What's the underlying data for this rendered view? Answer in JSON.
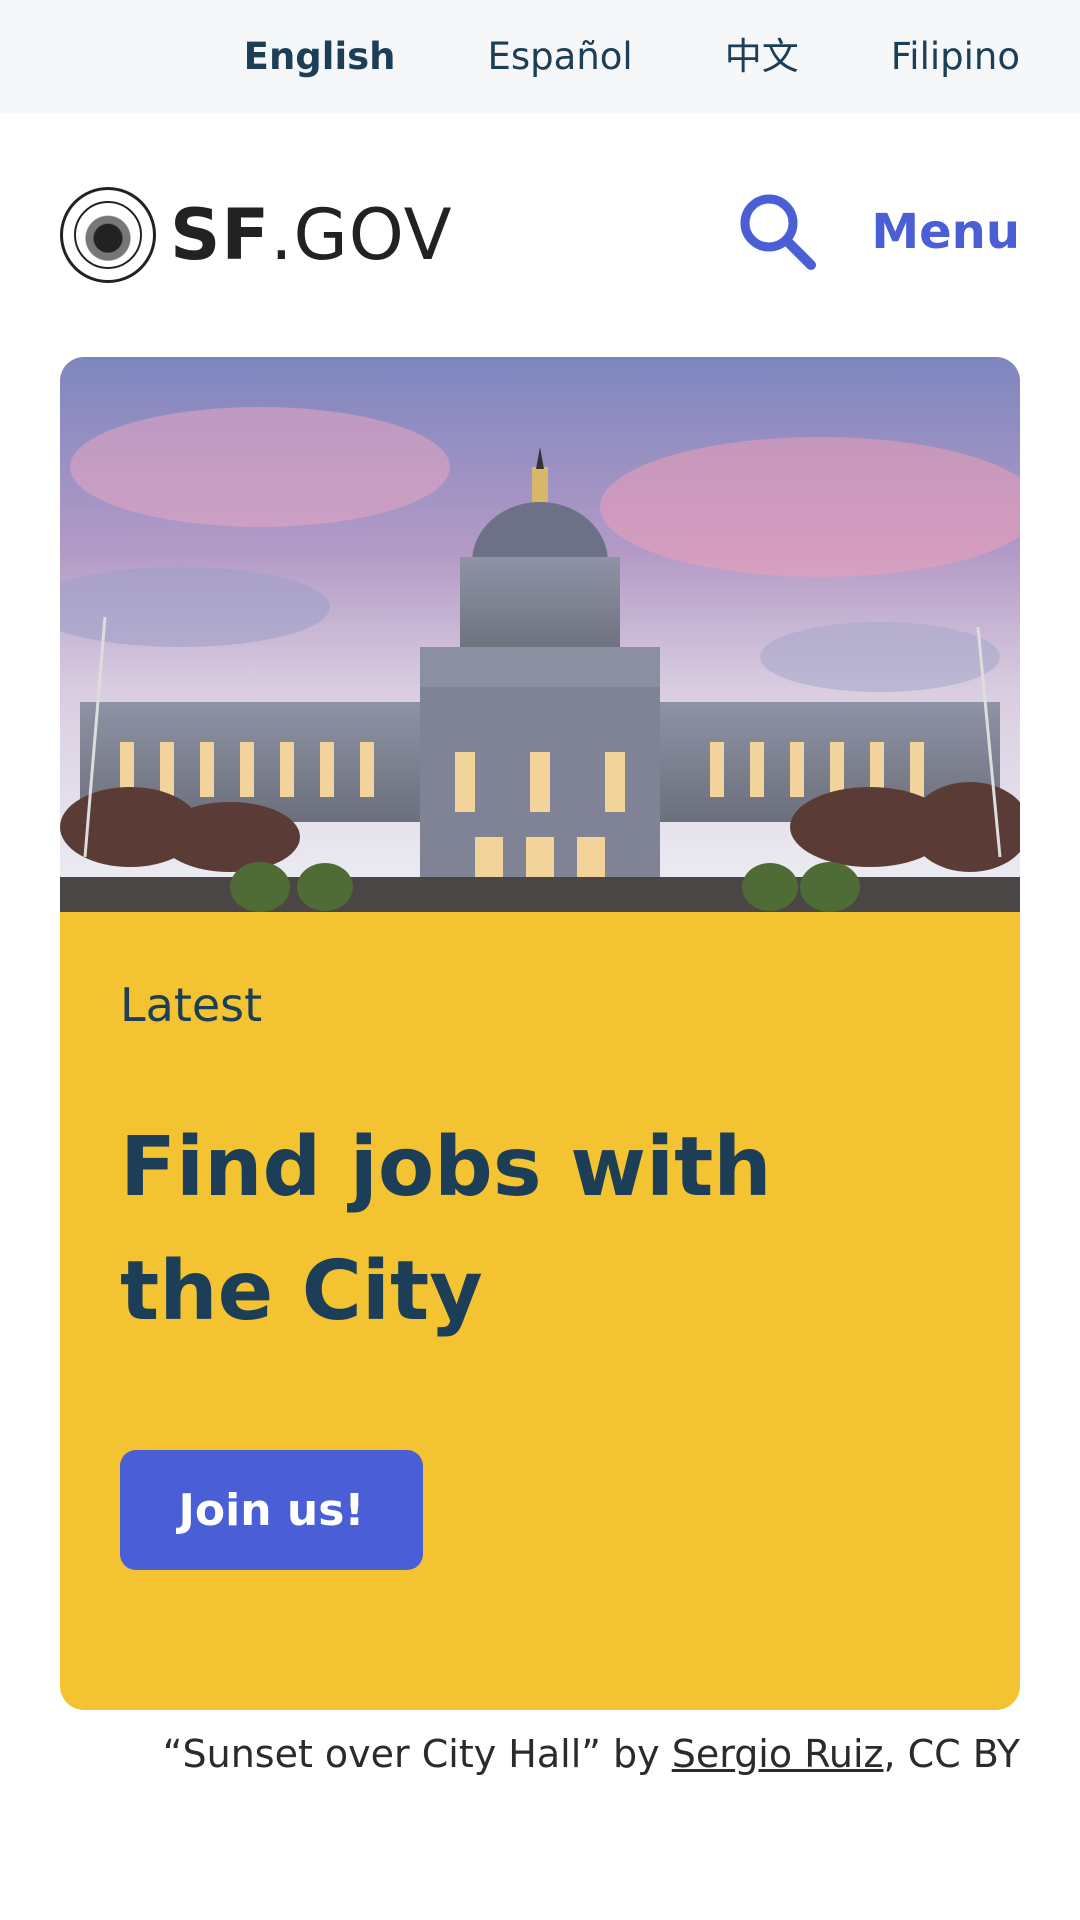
{
  "languages": [
    {
      "label": "English",
      "active": true
    },
    {
      "label": "Español",
      "active": false
    },
    {
      "label": "中文",
      "active": false
    },
    {
      "label": "Filipino",
      "active": false
    }
  ],
  "header": {
    "logo_bold": "SF",
    "logo_rest": ".GOV",
    "search_icon": "search-icon",
    "menu_label": "Menu"
  },
  "hero": {
    "eyebrow": "Latest",
    "headline": "Find jobs with the City",
    "cta_label": "Join us!"
  },
  "credit": {
    "prefix": "“Sunset over City Hall” by ",
    "author": "Sergio Ruiz",
    "suffix": ", CC BY"
  },
  "colors": {
    "accent": "#4a5fd6",
    "card_yellow": "#f4c332",
    "text_navy": "#1c3e57",
    "lang_bar_bg": "#f6f7f8"
  }
}
